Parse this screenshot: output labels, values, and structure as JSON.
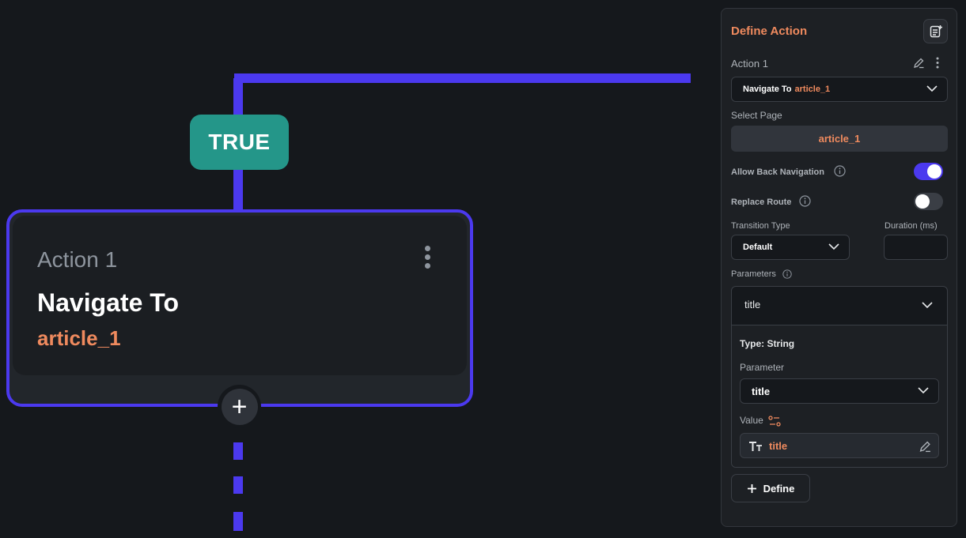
{
  "canvas": {
    "branch_label": "TRUE",
    "node": {
      "title": "Action 1",
      "action_name": "Navigate To",
      "target": "article_1",
      "add_symbol": "+"
    }
  },
  "panel": {
    "title": "Define Action",
    "action_label": "Action 1",
    "action_dropdown": {
      "prefix": "Navigate To",
      "value": "article_1"
    },
    "select_page_label": "Select Page",
    "selected_page": "article_1",
    "allow_back_label": "Allow Back Navigation",
    "allow_back_on": true,
    "replace_route_label": "Replace Route",
    "replace_route_on": false,
    "transition_type_label": "Transition Type",
    "transition_value": "Default",
    "duration_label": "Duration (ms)",
    "duration_value": "",
    "parameters_label": "Parameters",
    "parameter_row": {
      "name": "title",
      "type_text": "Type: String",
      "parameter_label": "Parameter",
      "parameter_value": "title",
      "value_label": "Value",
      "value_text": "title"
    },
    "define_button": "Define"
  },
  "colors": {
    "accent": "#4b39ef",
    "orange": "#ef8a5e",
    "teal": "#249689",
    "background": "#15181c"
  }
}
